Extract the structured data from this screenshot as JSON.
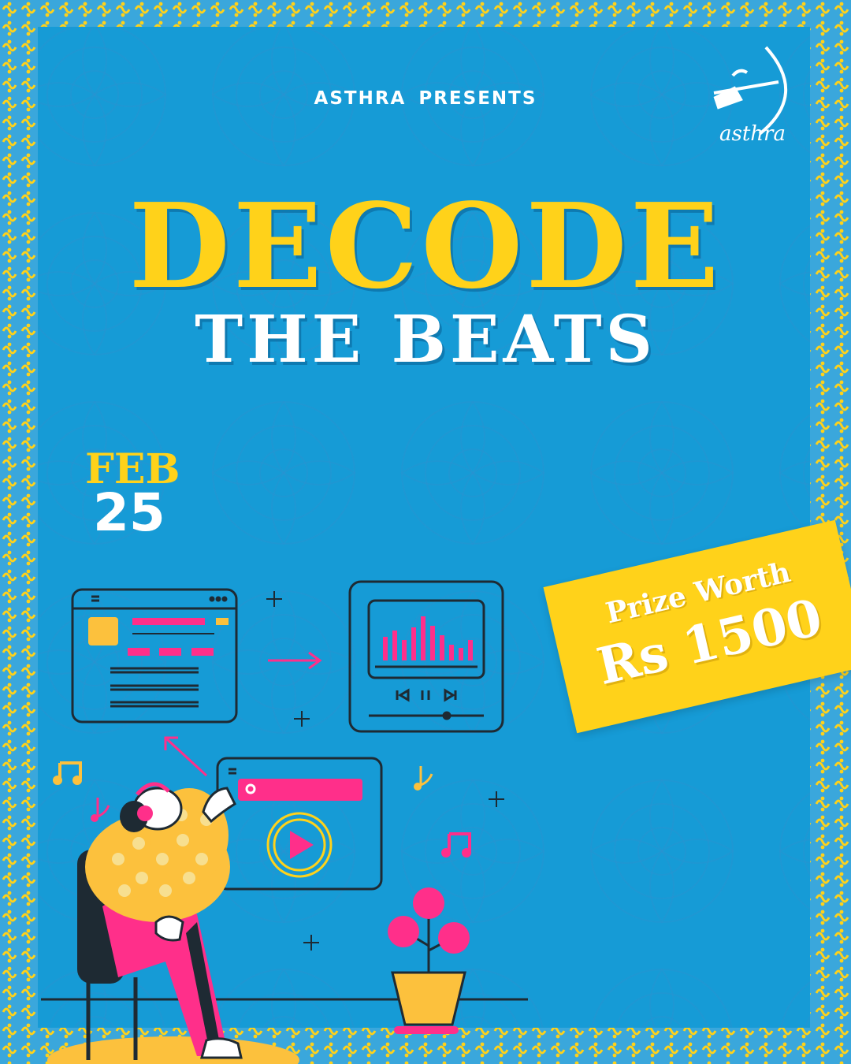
{
  "header": {
    "presents": "ASTHRA PRESENTS"
  },
  "title": {
    "line1": "DECODE",
    "line2": "THE BEATS"
  },
  "date": {
    "month": "FEB",
    "day": "25"
  },
  "prize": {
    "line1": "Prize Worth",
    "line2": "Rs 1500"
  },
  "logo": {
    "text": "asthra",
    "icon": "archer-bow-icon"
  },
  "colors": {
    "background": "#169bd6",
    "accent_yellow": "#ffd21a",
    "accent_pink": "#ff2f8a",
    "ink": "#1e2a33",
    "white": "#ffffff"
  }
}
